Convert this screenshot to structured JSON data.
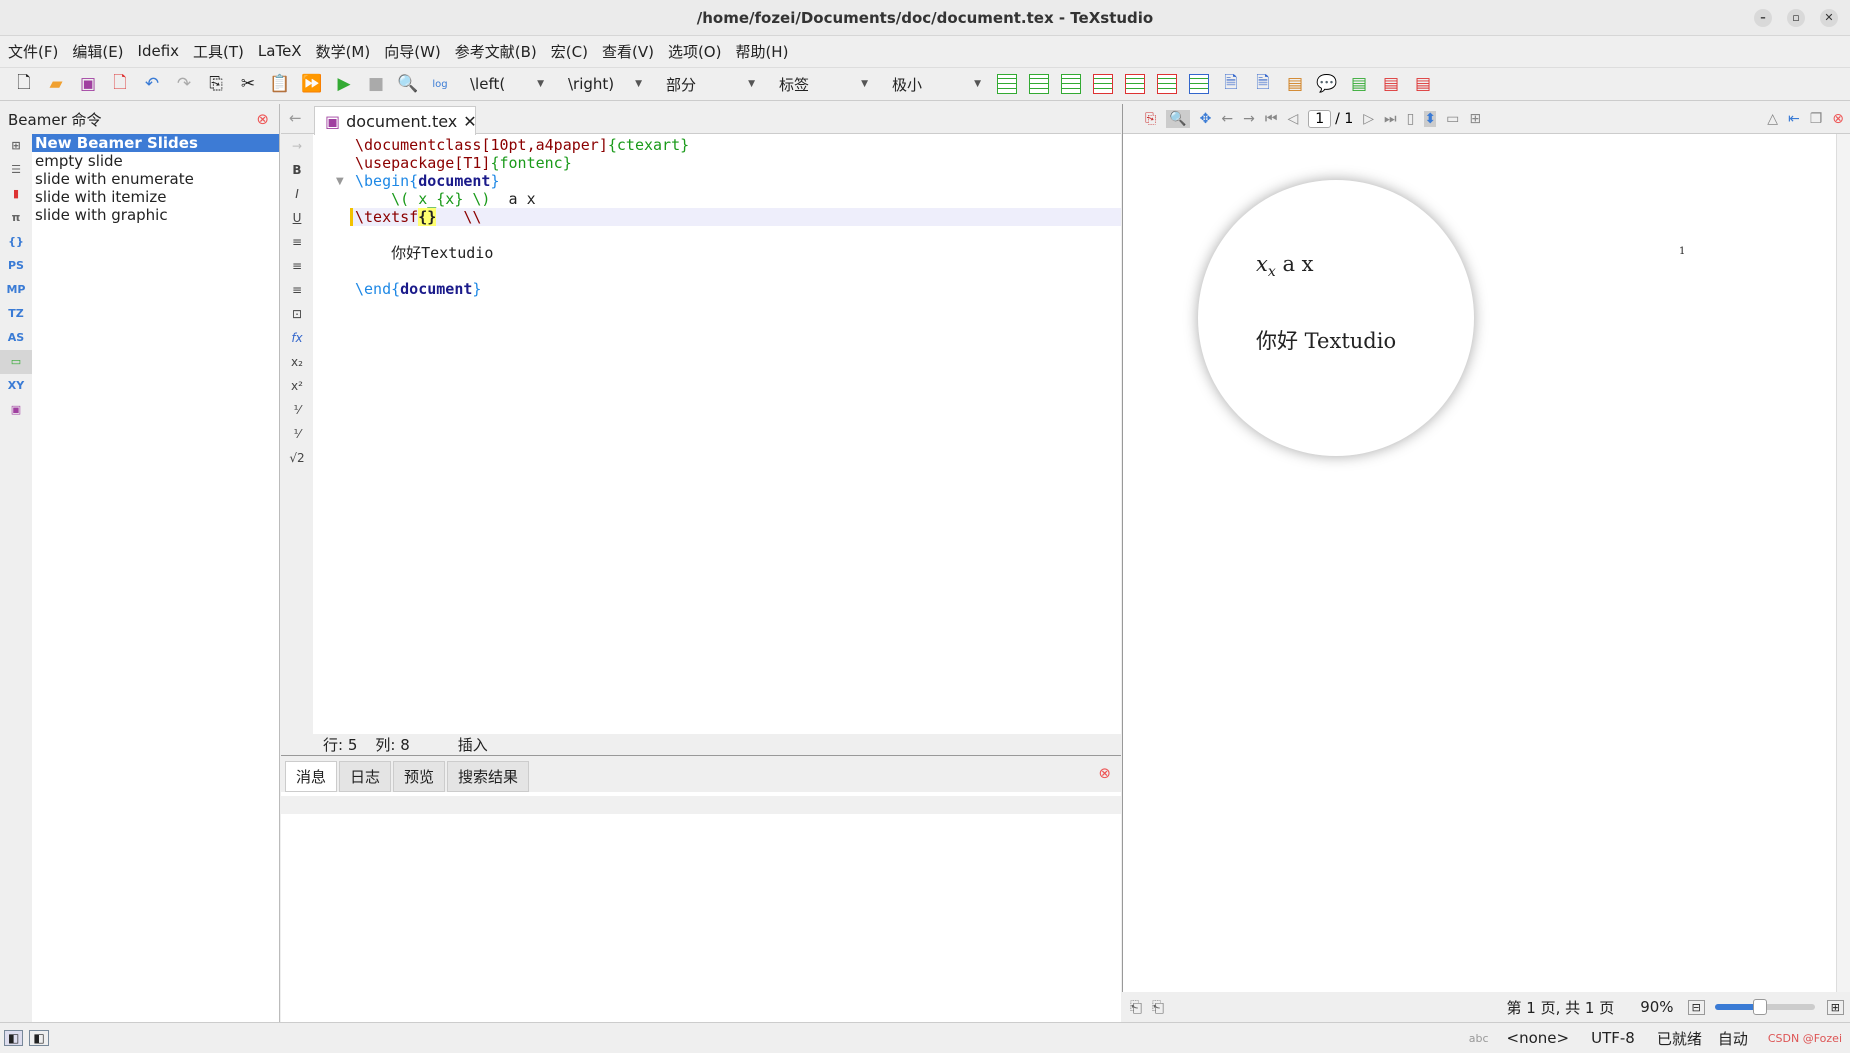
{
  "window": {
    "title": "/home/fozei/Documents/doc/document.tex - TeXstudio"
  },
  "menu": [
    "文件(F)",
    "编辑(E)",
    "Idefix",
    "工具(T)",
    "LaTeX",
    "数学(M)",
    "向导(W)",
    "参考文献(B)",
    "宏(C)",
    "查看(V)",
    "选项(O)",
    "帮助(H)"
  ],
  "toolbar": {
    "left_combo": "\\left(",
    "right_combo": "\\right)",
    "section_combo": "部分",
    "label_combo": "标签",
    "size_combo": "极小",
    "log_label": "log"
  },
  "left_panel": {
    "title": "Beamer 命令",
    "side_icons": [
      "PS",
      "MP",
      "TZ",
      "AS",
      "XY"
    ],
    "items": [
      "New Beamer Slides",
      "empty slide",
      "slide with enumerate",
      "slide with itemize",
      "slide with graphic"
    ]
  },
  "editor": {
    "tab": "document.tex",
    "side": [
      "B",
      "I",
      "U",
      "fx",
      "x₂",
      "x²",
      "√2"
    ],
    "lines": [
      [
        [
          "kw",
          "\\documentclass"
        ],
        [
          "kw",
          "[10pt,a4paper]"
        ],
        [
          "gr",
          "{ctexart}"
        ]
      ],
      [
        [
          "kw",
          "\\usepackage"
        ],
        [
          "kw",
          "[T1]"
        ],
        [
          "gr",
          "{fontenc}"
        ]
      ],
      [
        [
          "bl",
          "\\begin{"
        ],
        [
          "db",
          "document"
        ],
        [
          "bl",
          "}"
        ]
      ],
      [
        [
          "gr",
          "    \\( x_{x} \\)"
        ],
        [
          "",
          "  a x"
        ]
      ],
      [
        [
          "kw",
          "\\textsf"
        ],
        [
          "cb",
          "{}"
        ],
        [
          "kw",
          "   \\\\"
        ]
      ],
      [
        [
          "",
          ""
        ]
      ],
      [
        [
          "",
          "    你好Textudio"
        ]
      ],
      [
        [
          "",
          ""
        ]
      ],
      [
        [
          "bl",
          "\\end{"
        ],
        [
          "db",
          "document"
        ],
        [
          "bl",
          "}"
        ]
      ]
    ],
    "status": {
      "line_label": "行: 5",
      "col_label": "列: 8",
      "mode": "插入"
    }
  },
  "messages": {
    "tabs": [
      "消息",
      "日志",
      "预览",
      "搜索结果"
    ]
  },
  "pdf": {
    "page_current": "1",
    "page_total": "/ 1",
    "page_number": "1",
    "lens_line1_math": "x",
    "lens_line1_sub": "x",
    "lens_line1_rest": "a x",
    "lens_line2": "你好 Textudio",
    "page_info": "第 1 页, 共 1 页",
    "zoom": "90%",
    "zoom_slider_fraction": 0.45
  },
  "statusbar": {
    "spell": "abc",
    "language": "<none>",
    "encoding": "UTF-8",
    "state": "已就绪",
    "auto": "自动",
    "watermark": "CSDN @Fozei"
  }
}
